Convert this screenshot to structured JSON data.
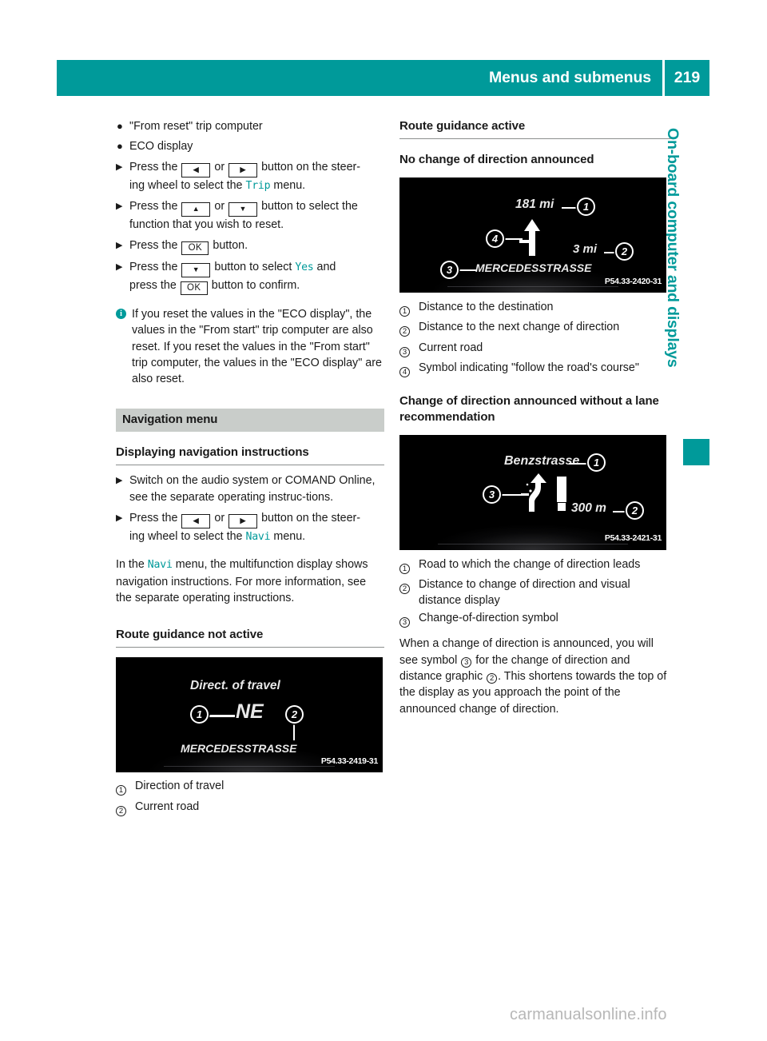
{
  "header": {
    "title": "Menus and submenus",
    "page_number": "219"
  },
  "side_tab": {
    "label": "On-board computer and displays"
  },
  "left_column": {
    "bullets": [
      "\"From reset\" trip computer",
      "ECO display"
    ],
    "steps": [
      {
        "pre": "Press the",
        "key1": "◀",
        "mid": "or",
        "key2": "▶",
        "post": "button on the steer-",
        "line2_pre": "ing wheel to select the",
        "line2_mono": "Trip",
        "line2_post": "menu."
      },
      {
        "pre": "Press the",
        "key1": "▲",
        "mid": "or",
        "key2": "▼",
        "post": "button to select the",
        "line2_pre": "function that you wish to reset.",
        "line2_mono": "",
        "line2_post": ""
      },
      {
        "pre": "Press the",
        "key1": "OK",
        "post": "button."
      },
      {
        "pre": "Press the",
        "key1": "▼",
        "post": "button to select",
        "mono": "Yes",
        "tail": "and",
        "line2_pre": "press the",
        "line2_key": "OK",
        "line2_post": "button to confirm."
      }
    ],
    "note": "If you reset the values in the \"ECO display\", the values in the \"From start\" trip computer are also reset. If you reset the values in the \"From start\" trip computer, the values in the \"ECO display\" are also reset.",
    "note_icon": "i",
    "section_heading": "Navigation menu",
    "sub_heading": "Displaying navigation instructions",
    "nav_step1": "Switch on the audio system or COMAND Online, see the separate operating instruc-tions.",
    "nav_step2": {
      "pre": "Press the",
      "key1": "◀",
      "mid": "or",
      "key2": "▶",
      "post": "button on the steer-",
      "line2_pre": "ing wheel to select the",
      "line2_mono": "Navi",
      "line2_post": "menu."
    },
    "paragraph": {
      "p1": "In the",
      "mono": "Navi",
      "p2": "menu, the multifunction display shows navigation instructions. For more information, see the separate operating instructions."
    },
    "heading_route_not_active": "Route guidance not active",
    "figure1": {
      "title": "Direct. of travel",
      "direction": "NE",
      "road": "MERCEDESSTRASSE",
      "code": "P54.33-2419-31",
      "callouts": [
        "1",
        "2"
      ]
    },
    "legend1": [
      {
        "num": "1",
        "text": "Direction of travel"
      },
      {
        "num": "2",
        "text": "Current road"
      }
    ]
  },
  "right_column": {
    "heading_route_active": "Route guidance active",
    "heading_no_change": "No change of direction announced",
    "figure2": {
      "dist_destination": "181 mi",
      "dist_next": "3 mi",
      "road": "MERCEDESSTRASSE",
      "code": "P54.33-2420-31",
      "callouts": [
        "1",
        "2",
        "3",
        "4"
      ]
    },
    "legend2": [
      {
        "num": "1",
        "text": "Distance to the destination"
      },
      {
        "num": "2",
        "text": "Distance to the next change of direction"
      },
      {
        "num": "3",
        "text": "Current road"
      },
      {
        "num": "4",
        "text": "Symbol indicating \"follow the road's course\""
      }
    ],
    "heading_change_announced": "Change of direction announced without a lane recommendation",
    "figure3": {
      "street": "Benzstrasse",
      "distance": "300 m",
      "code": "P54.33-2421-31",
      "callouts": [
        "1",
        "2",
        "3"
      ]
    },
    "legend3": [
      {
        "num": "1",
        "text": "Road to which the change of direction leads"
      },
      {
        "num": "2",
        "text": "Distance to change of direction and visual distance display"
      },
      {
        "num": "3",
        "text": "Change-of-direction symbol"
      }
    ],
    "closing_paragraph": {
      "part1": "When a change of direction is announced, you will see symbol",
      "ref1": "3",
      "part2": "for the change of direction and distance graphic",
      "ref2": "2",
      "part3": ". This shortens towards the top of the display as you approach the point of the announced change of direction."
    }
  },
  "watermark": "carmanualsonline.info",
  "colors": {
    "accent_teal": "#009a9a",
    "gray_band": "#c9cdca",
    "rule_gray": "#8c8f8e",
    "watermark_gray": "#b7b7b7"
  }
}
